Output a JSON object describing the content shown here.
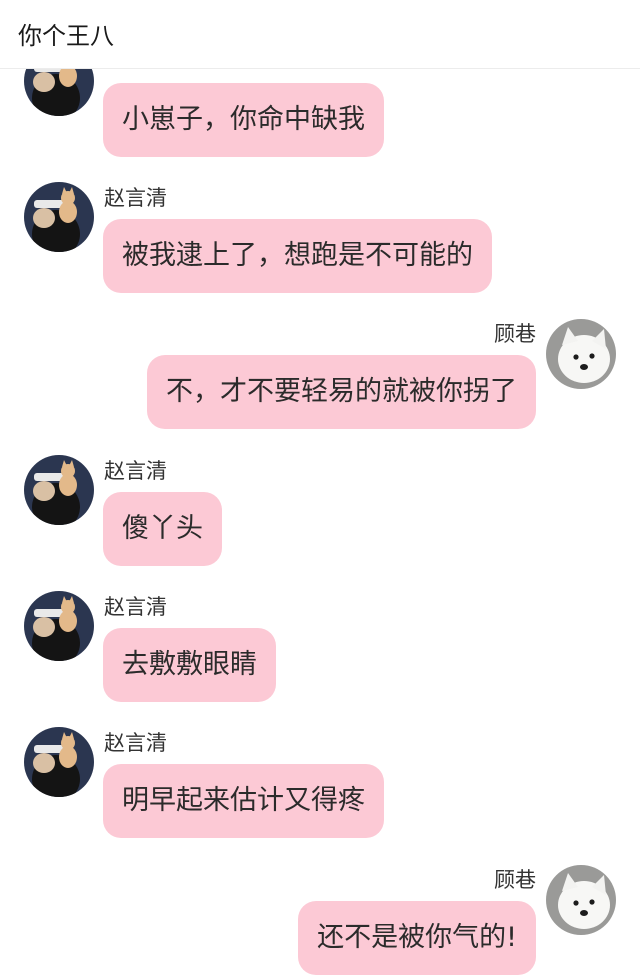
{
  "header": {
    "title": "你个王八"
  },
  "colors": {
    "bubble": "#fcc9d5",
    "background": "#ffffff"
  },
  "messages": [
    {
      "side": "left",
      "sender": "",
      "text": "小崽子，你命中缺我",
      "avatar_icon": "kitten-on-head-avatar-icon"
    },
    {
      "side": "left",
      "sender": "赵言清",
      "text": "被我逮上了，想跑是不可能的",
      "avatar_icon": "kitten-on-head-avatar-icon"
    },
    {
      "side": "right",
      "sender": "顾巷",
      "text": "不，才不要轻易的就被你拐了",
      "avatar_icon": "white-puppy-avatar-icon"
    },
    {
      "side": "left",
      "sender": "赵言清",
      "text": "傻丫头",
      "avatar_icon": "kitten-on-head-avatar-icon"
    },
    {
      "side": "left",
      "sender": "赵言清",
      "text": "去敷敷眼睛",
      "avatar_icon": "kitten-on-head-avatar-icon"
    },
    {
      "side": "left",
      "sender": "赵言清",
      "text": "明早起来估计又得疼",
      "avatar_icon": "kitten-on-head-avatar-icon"
    },
    {
      "side": "right",
      "sender": "顾巷",
      "text": "还不是被你气的!",
      "avatar_icon": "white-puppy-avatar-icon"
    }
  ]
}
